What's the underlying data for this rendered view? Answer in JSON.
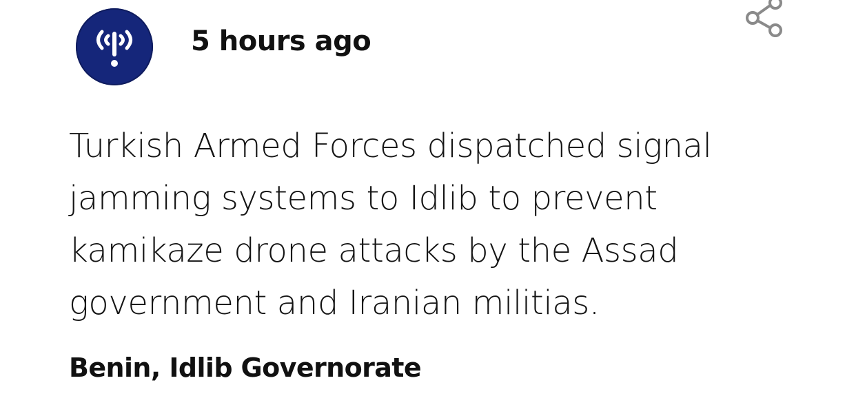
{
  "post": {
    "source_icon": "broadcast-signal-icon",
    "timestamp": "5 hours ago",
    "share_icon": "share-icon",
    "text": "Turkish Armed Forces dispatched signal jamming systems to Idlib to prevent kamikaze drone attacks by the Assad government and Iranian militias.",
    "location": "Benin, Idlib Governorate"
  },
  "colors": {
    "avatar_background": "#15267a",
    "text": "#141414",
    "share_icon": "#8a8a8a"
  }
}
